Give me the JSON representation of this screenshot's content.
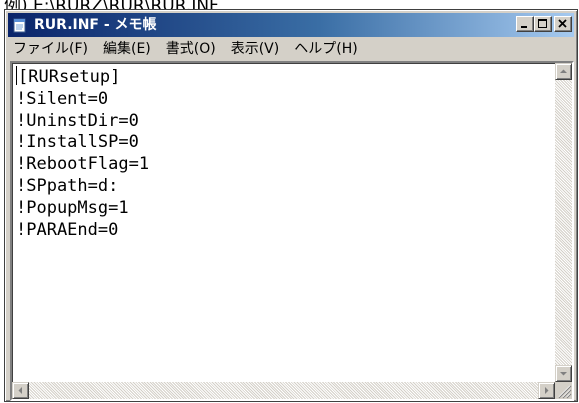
{
  "caption": "例) E:\\RURZ\\RUR\\RUR.INF",
  "window": {
    "title": "RUR.INF - メモ帳",
    "icon": "notepad-icon",
    "controls": {
      "minimize": "minimize-icon",
      "maximize": "maximize-icon",
      "close": "close-icon"
    }
  },
  "menu": {
    "file": "ファイル(F)",
    "edit": "編集(E)",
    "format": "書式(O)",
    "view": "表示(V)",
    "help": "ヘルプ(H)"
  },
  "editor": {
    "lines": [
      "[RURsetup]",
      "!Silent=0",
      "!UninstDir=0",
      "!InstallSP=0",
      "!RebootFlag=1",
      "!SPpath=d:",
      "!PopupMsg=1",
      "!PARAEnd=0"
    ]
  },
  "colors": {
    "title_gradient_start": "#0a246a",
    "title_gradient_end": "#a6caf0",
    "window_face": "#d4d0c8"
  }
}
